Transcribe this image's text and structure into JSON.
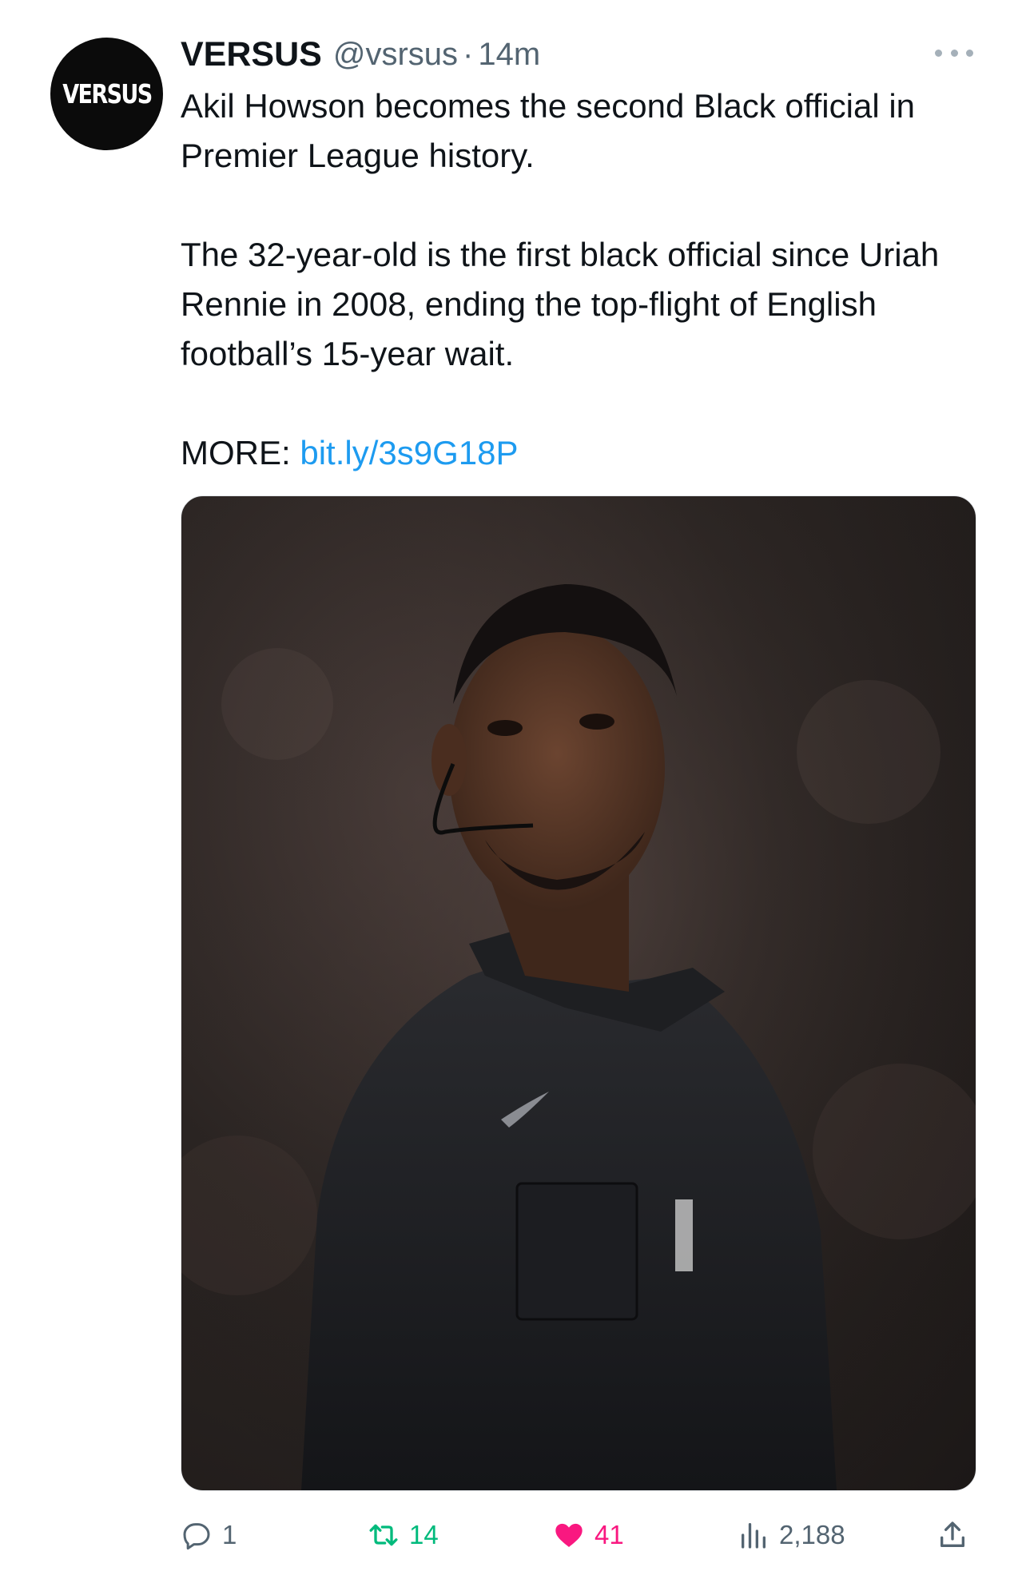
{
  "tweet": {
    "avatar_text": "VERSUS",
    "display_name": "VERSUS",
    "handle": "@vsrsus",
    "separator": "·",
    "time": "14m",
    "lines": [
      "Akil Howson becomes the second Black official in Premier League history.",
      "The 32-year-old is the first black official since Uriah Rennie in 2008, ending the top-flight of English football’s 15-year wait."
    ],
    "more_label": "MORE:",
    "link_text": "bit.ly/3s9G18P"
  },
  "actions": {
    "replies": "1",
    "retweets": "14",
    "likes": "41",
    "views": "2,188"
  },
  "colors": {
    "link": "#1d9bf0",
    "retweet": "#00ba7c",
    "like": "#f91880",
    "muted": "#536471"
  },
  "icons": [
    "more-icon",
    "reply-icon",
    "retweet-icon",
    "heart-icon",
    "views-icon",
    "share-icon"
  ]
}
